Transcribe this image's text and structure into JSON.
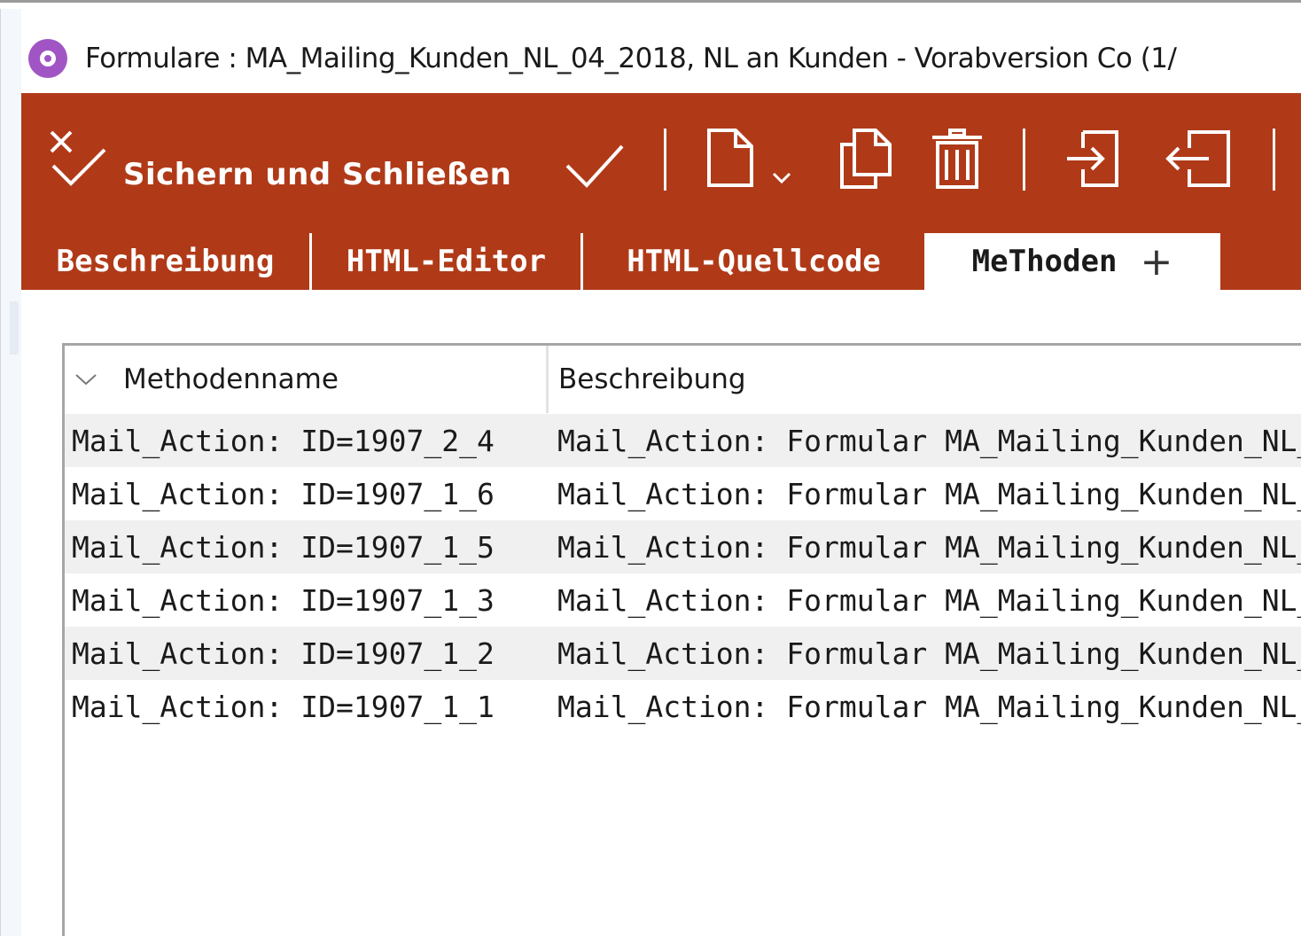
{
  "window": {
    "title": "Formulare : MA_Mailing_Kunden_NL_04_2018, NL an Kunden - Vorabversion Co (1/",
    "app_icon": "record-icon",
    "accent_color": "#b03a18",
    "app_icon_color": "#a155c4"
  },
  "toolbar": {
    "save_close_label": "Sichern und Schließen",
    "buttons": [
      "save-close-icon",
      "checkmark-icon",
      "new-document-icon",
      "dropdown-chevron-icon",
      "copy-icon",
      "trash-icon",
      "import-icon",
      "export-icon"
    ]
  },
  "tabs": [
    {
      "label": "Beschreibung",
      "active": false
    },
    {
      "label": "HTML-Editor",
      "active": false
    },
    {
      "label": "HTML-Quellcode",
      "active": false
    },
    {
      "label": "MeThoden",
      "active": true
    },
    {
      "label": "+",
      "active": false
    }
  ],
  "table": {
    "columns": [
      "Methodenname",
      "Beschreibung"
    ],
    "rows": [
      {
        "name": "Mail_Action: ID=1907_2_4",
        "desc": "Mail_Action: Formular MA_Mailing_Kunden_NL_"
      },
      {
        "name": "Mail_Action: ID=1907_1_6",
        "desc": "Mail_Action: Formular MA_Mailing_Kunden_NL_"
      },
      {
        "name": "Mail_Action: ID=1907_1_5",
        "desc": "Mail_Action: Formular MA_Mailing_Kunden_NL_"
      },
      {
        "name": "Mail_Action: ID=1907_1_3",
        "desc": "Mail_Action: Formular MA_Mailing_Kunden_NL_"
      },
      {
        "name": "Mail_Action: ID=1907_1_2",
        "desc": "Mail_Action: Formular MA_Mailing_Kunden_NL_"
      },
      {
        "name": "Mail_Action: ID=1907_1_1",
        "desc": "Mail_Action: Formular MA_Mailing_Kunden_NL_"
      }
    ]
  }
}
